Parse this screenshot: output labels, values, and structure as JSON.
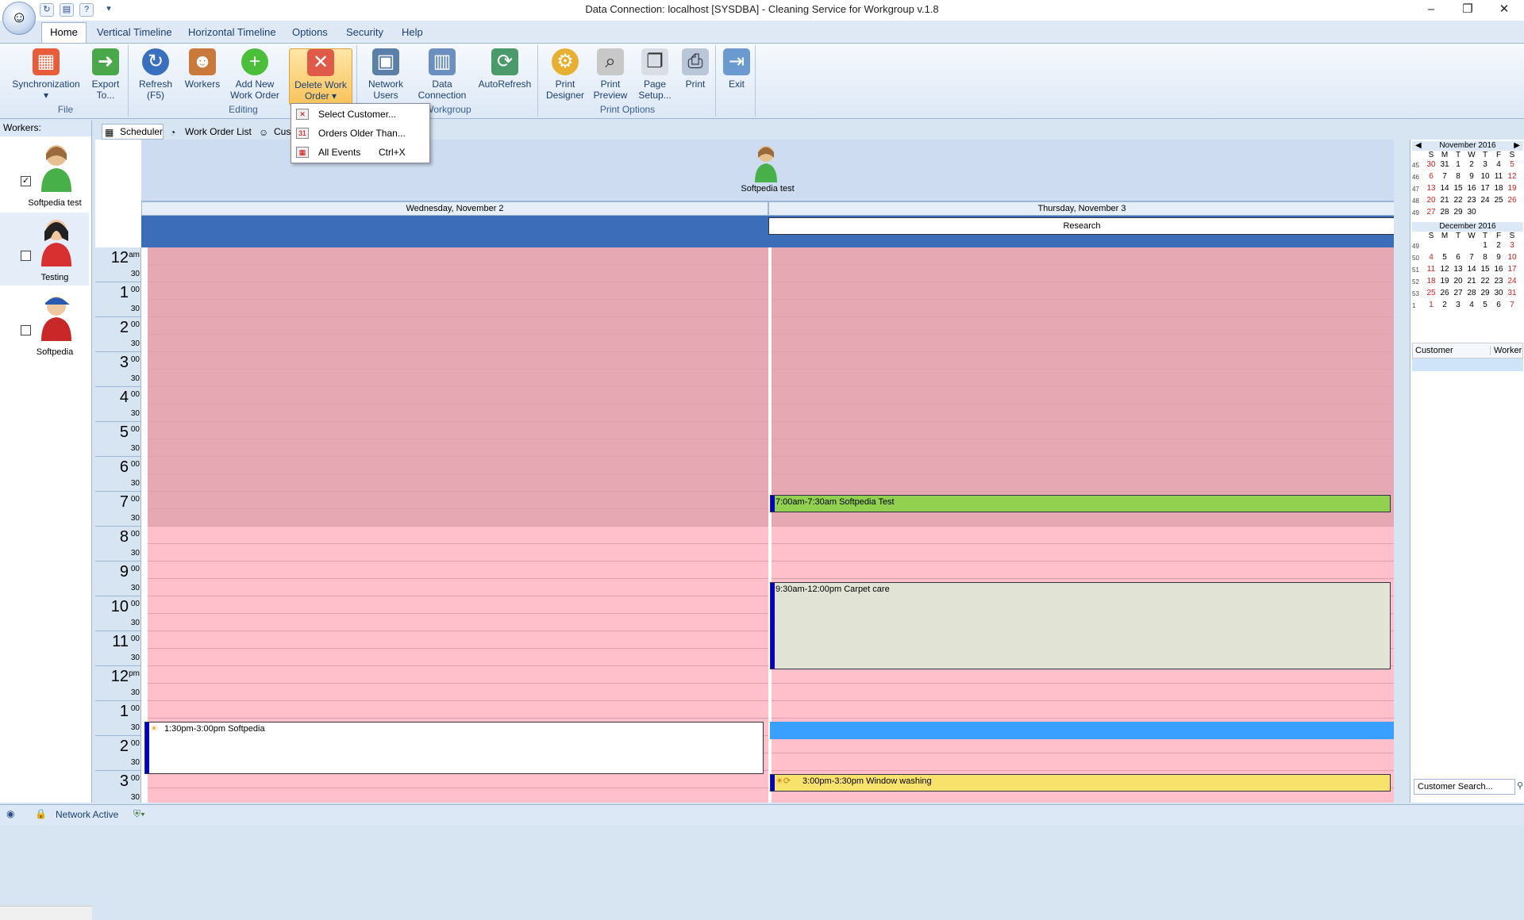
{
  "window": {
    "title": "Data Connection: localhost [SYSDBA] - Cleaning Service for Workgroup v.1.8"
  },
  "ribbon_tabs": [
    "Home",
    "Vertical Timeline",
    "Horizontal Timeline",
    "Options",
    "Security",
    "Help"
  ],
  "ribbon": {
    "file": {
      "label": "File",
      "sync": "Synchronization",
      "export": "Export To..."
    },
    "editing": {
      "label": "Editing",
      "refresh": "Refresh (F5)",
      "workers": "Workers",
      "add": "Add New Work Order",
      "delete": "Delete Work Order"
    },
    "workgroup": {
      "label": "Workgroup",
      "network": "Network Users",
      "data": "Data Connection",
      "auto": "AutoRefresh"
    },
    "print": {
      "label": "Print Options",
      "designer": "Print Designer",
      "preview": "Print Preview",
      "setup": "Page Setup...",
      "print": "Print"
    },
    "exit": "Exit"
  },
  "delete_menu": {
    "items": [
      {
        "label": "Select Customer...",
        "shortcut": ""
      },
      {
        "label": "Orders Older Than...",
        "shortcut": ""
      },
      {
        "label": "All Events",
        "shortcut": "Ctrl+X"
      }
    ]
  },
  "workers_panel": {
    "header": "Workers:",
    "workers": [
      {
        "name": "Softpedia test",
        "checked": true
      },
      {
        "name": "Testing",
        "checked": false
      },
      {
        "name": "Softpedia",
        "checked": false
      }
    ]
  },
  "view_tabs": [
    "Scheduler",
    "Work Order List",
    "Cust"
  ],
  "scheduler": {
    "resource": "Softpedia test",
    "days": [
      "Wednesday, November 2",
      "Thursday, November 3"
    ],
    "all_day_event": "Research",
    "hours": [
      "12",
      "1",
      "2",
      "3",
      "4",
      "5",
      "6",
      "7",
      "8",
      "9",
      "10",
      "11",
      "12",
      "1",
      "2",
      "3"
    ],
    "hour_suffix": [
      "am",
      "00",
      "00",
      "00",
      "00",
      "00",
      "00",
      "00",
      "00",
      "00",
      "00",
      "00",
      "pm",
      "00",
      "00",
      "00"
    ],
    "half": "30",
    "events": [
      {
        "text": "7:00am-7:30am Softpedia Test",
        "color": "#92d050"
      },
      {
        "text": "9:30am-12:00pm Carpet care",
        "color": "#e1e4d4"
      },
      {
        "text": "1:30pm-3:00pm Softpedia",
        "color": "#ffffff"
      },
      {
        "text": "3:00pm-3:30pm Window washing",
        "color": "#f9e26b"
      }
    ]
  },
  "calendar": {
    "months": [
      {
        "title": "November 2016",
        "weeks": [
          "45",
          "46",
          "47",
          "48",
          "49"
        ],
        "days": [
          [
            "30",
            "31",
            "1",
            "2",
            "3",
            "4",
            "5"
          ],
          [
            "6",
            "7",
            "8",
            "9",
            "10",
            "11",
            "12"
          ],
          [
            "13",
            "14",
            "15",
            "16",
            "17",
            "18",
            "19"
          ],
          [
            "20",
            "21",
            "22",
            "23",
            "24",
            "25",
            "26"
          ],
          [
            "27",
            "28",
            "29",
            "30",
            "",
            "",
            ""
          ]
        ]
      },
      {
        "title": "December 2016",
        "weeks": [
          "49",
          "50",
          "51",
          "52",
          "53",
          "1"
        ],
        "days": [
          [
            "",
            "",
            "",
            "",
            "1",
            "2",
            "3"
          ],
          [
            "4",
            "5",
            "6",
            "7",
            "8",
            "9",
            "10"
          ],
          [
            "11",
            "12",
            "13",
            "14",
            "15",
            "16",
            "17"
          ],
          [
            "18",
            "19",
            "20",
            "21",
            "22",
            "23",
            "24"
          ],
          [
            "25",
            "26",
            "27",
            "28",
            "29",
            "30",
            "31"
          ],
          [
            "1",
            "2",
            "3",
            "4",
            "5",
            "6",
            "7"
          ]
        ]
      }
    ],
    "day_names": [
      "S",
      "M",
      "T",
      "W",
      "T",
      "F",
      "S"
    ]
  },
  "customer_grid": {
    "columns": [
      "Customer",
      "Worker"
    ]
  },
  "customer_search": "Customer Search...",
  "status": {
    "network": "Network Active"
  },
  "colors": {
    "accent": "#3c6db8",
    "pink": "#ffc0cb",
    "pink_dark": "#e6a9b4"
  }
}
